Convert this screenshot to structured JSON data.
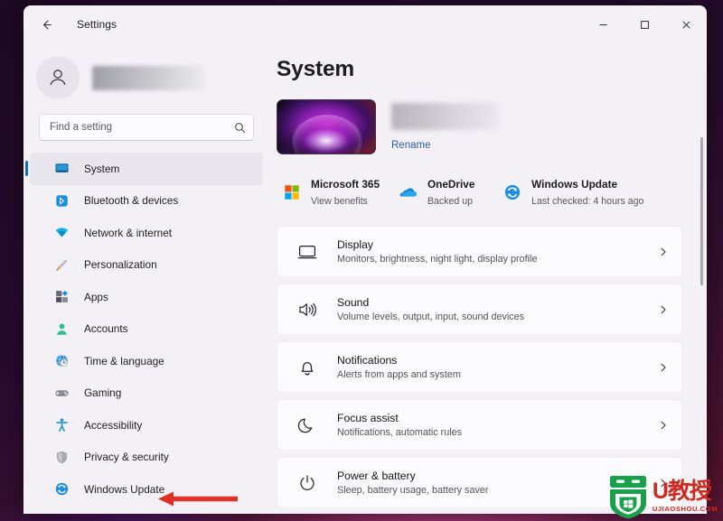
{
  "window": {
    "title": "Settings",
    "back_icon": "back-arrow-icon",
    "minimize_label": "─",
    "maximize_label": "□",
    "close_label": "✕"
  },
  "sidebar": {
    "account": {
      "avatar_icon": "person-avatar-icon",
      "name_redacted": true
    },
    "search": {
      "placeholder": "Find a setting",
      "value": "",
      "icon": "search-icon"
    },
    "items": [
      {
        "label": "System",
        "icon": "system-monitor-icon",
        "active": true
      },
      {
        "label": "Bluetooth & devices",
        "icon": "bluetooth-icon",
        "active": false
      },
      {
        "label": "Network & internet",
        "icon": "wifi-icon",
        "active": false
      },
      {
        "label": "Personalization",
        "icon": "paintbrush-icon",
        "active": false
      },
      {
        "label": "Apps",
        "icon": "apps-grid-icon",
        "active": false
      },
      {
        "label": "Accounts",
        "icon": "account-person-icon",
        "active": false
      },
      {
        "label": "Time & language",
        "icon": "clock-globe-icon",
        "active": false
      },
      {
        "label": "Gaming",
        "icon": "gamepad-icon",
        "active": false
      },
      {
        "label": "Accessibility",
        "icon": "accessibility-icon",
        "active": false
      },
      {
        "label": "Privacy & security",
        "icon": "shield-icon",
        "active": false
      },
      {
        "label": "Windows Update",
        "icon": "windows-update-icon",
        "active": false
      }
    ]
  },
  "main": {
    "page_title": "System",
    "device": {
      "thumbnail_icon": "device-bloom-thumbnail",
      "name_redacted": true,
      "rename_label": "Rename"
    },
    "services": [
      {
        "title": "Microsoft 365",
        "subtitle": "View benefits",
        "icon": "microsoft-365-icon"
      },
      {
        "title": "OneDrive",
        "subtitle": "Backed up",
        "icon": "onedrive-cloud-icon"
      },
      {
        "title": "Windows Update",
        "subtitle": "Last checked: 4 hours ago",
        "icon": "windows-update-icon"
      }
    ],
    "cards": [
      {
        "title": "Display",
        "subtitle": "Monitors, brightness, night light, display profile",
        "icon": "display-monitor-icon",
        "chevron": "›"
      },
      {
        "title": "Sound",
        "subtitle": "Volume levels, output, input, sound devices",
        "icon": "speaker-icon",
        "chevron": "›"
      },
      {
        "title": "Notifications",
        "subtitle": "Alerts from apps and system",
        "icon": "bell-icon",
        "chevron": "›"
      },
      {
        "title": "Focus assist",
        "subtitle": "Notifications, automatic rules",
        "icon": "moon-icon",
        "chevron": "›"
      },
      {
        "title": "Power & battery",
        "subtitle": "Sleep, battery usage, battery saver",
        "icon": "power-icon",
        "chevron": "›"
      }
    ]
  },
  "annotation": {
    "arrow_icon": "red-left-arrow-annotation",
    "arrow_color": "#e03127",
    "points_at": "Windows Update"
  },
  "watermark": {
    "logo_icon": "green-shield-windows-logo",
    "brand_cn": "U教授",
    "url": "UJIAOSHOU.COM",
    "brand_color": "#cf2a1e",
    "logo_color": "#18a04a"
  },
  "colors": {
    "accent": "#0d6fbe",
    "window_bg": "#f3f0f6",
    "card_bg": "#fbfafd",
    "desktop": "#1d0a22"
  }
}
